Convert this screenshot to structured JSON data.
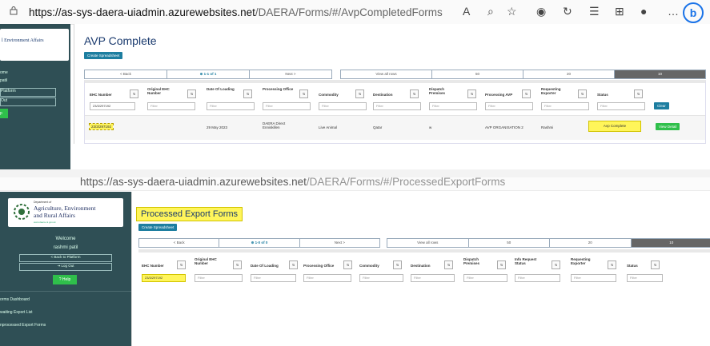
{
  "top": {
    "address": {
      "domain": "https://as-sys-daera-uiadmin.azurewebsites.net",
      "path": "/DAERA/Forms/#/AvpCompletedForms"
    },
    "sidebar": {
      "logo_text": "l Environment Affairs",
      "items": [
        "ome",
        "patil",
        "Platform",
        "Out",
        "p"
      ]
    },
    "page_title": "AVP Complete",
    "create_btn": "Create Spreadsheet",
    "pager": [
      "< Back",
      "⊕ 1-1 of 1",
      "Next >",
      "View all rows",
      "50",
      "20",
      "10"
    ],
    "columns": [
      "EHC Number",
      "Original EHC Number",
      "Date Of Loading",
      "Processing Office",
      "Commodity",
      "Destination",
      "Dispatch Premises",
      "Processing AVP",
      "Requesting Exporter",
      "Status"
    ],
    "filter_ehc": "23/3/297192",
    "filter_placeholder": "Filter",
    "clear_btn": "Clear",
    "row": {
      "ehc": "23/3/297192",
      "date": "29 May 2023",
      "office": "DAERA Direct Enniskillen",
      "commodity": "Live Animal",
      "destination": "Qatar",
      "premises": "w",
      "avp": "AVP ORGANISATION 2",
      "exporter": "Rashmi",
      "status": "Avp Complete",
      "action": "View Detail"
    }
  },
  "bottom": {
    "address": {
      "domain": "https://as-sys-daera-uiadmin.azurewebsites.net",
      "path": "/DAERA/Forms/#/ProcessedExportForms"
    },
    "sidebar": {
      "logo_small": "Department of",
      "logo_line1": "Agriculture, Environment",
      "logo_line2": "and Rural Affairs",
      "logo_sub": "www.daera-ni.gov.uk",
      "welcome": "Welcome",
      "user": "rashmi patil",
      "back": "< Back to Platform",
      "logout": "⇥ Log Out",
      "help": "? Help",
      "nav": [
        "orms Dashboard",
        "waiting Export List",
        "nprocessed Export Forms"
      ]
    },
    "page_title": "Processed Export Forms",
    "create_btn": "Create Spreadsheet",
    "pager": [
      "< Back",
      "⊕ 1-0 of 0",
      "Next >",
      "View all rows",
      "50",
      "20",
      "10"
    ],
    "columns": [
      "EHC Number",
      "Original EHC Number",
      "Date Of Loading",
      "Processing Office",
      "Commodity",
      "Destination",
      "Dispatch Premises",
      "Info Request Status",
      "Requesting Exporter",
      "Status"
    ],
    "filter_ehc": "23/3/297192",
    "filter_placeholder": "Filter"
  },
  "colors": {
    "sidebar": "#2f4f55",
    "highlight": "#fff55a",
    "status_green": "#2fbf4b",
    "btn_blue": "#1d7ea0"
  }
}
